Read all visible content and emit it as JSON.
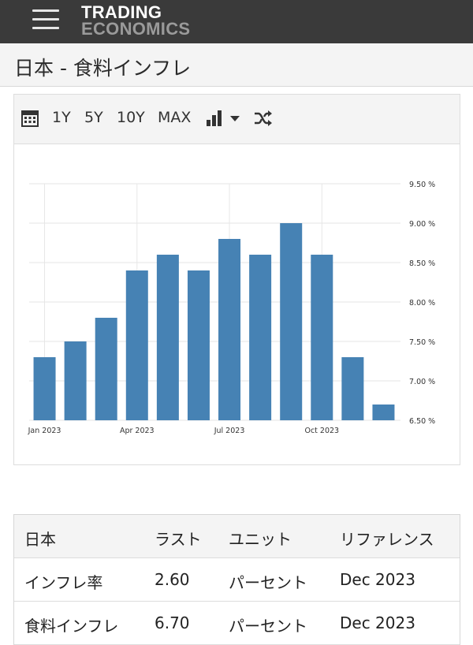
{
  "header": {
    "menu_icon": "hamburger-icon",
    "logo_line1": "TRADING",
    "logo_line2": "ECONOMICS"
  },
  "page": {
    "title": "日本 - 食料インフレ"
  },
  "toolbar": {
    "calendar_icon": "calendar-icon",
    "range_buttons": [
      "1Y",
      "5Y",
      "10Y",
      "MAX"
    ],
    "chart_type_icon": "bar-chart-icon",
    "dropdown_icon": "chevron-down-icon",
    "shuffle_icon": "shuffle-icon"
  },
  "chart_data": {
    "type": "bar",
    "categories": [
      "Jan 2023",
      "Feb 2023",
      "Mar 2023",
      "Apr 2023",
      "May 2023",
      "Jun 2023",
      "Jul 2023",
      "Aug 2023",
      "Sep 2023",
      "Oct 2023",
      "Nov 2023",
      "Dec 2023"
    ],
    "values": [
      7.3,
      7.5,
      7.8,
      8.4,
      8.6,
      8.4,
      8.8,
      8.6,
      9.0,
      8.6,
      7.3,
      6.7
    ],
    "ylim": [
      6.5,
      9.5
    ],
    "yticks": [
      9.5,
      9.0,
      8.5,
      8.0,
      7.5,
      7.0,
      6.5
    ],
    "ytick_labels": [
      "9.50 %",
      "9.00 %",
      "8.50 %",
      "8.00 %",
      "7.50 %",
      "7.00 %",
      "6.50 %"
    ],
    "xtick_labels": [
      {
        "index": 0,
        "label": "Jan 2023"
      },
      {
        "index": 3,
        "label": "Apr 2023"
      },
      {
        "index": 6,
        "label": "Jul 2023"
      },
      {
        "index": 9,
        "label": "Oct 2023"
      }
    ],
    "bar_color": "#4682b4",
    "grid": true,
    "y_axis_side": "right",
    "title": "",
    "xlabel": "",
    "ylabel": ""
  },
  "table": {
    "headers": [
      "日本",
      "ラスト",
      "ユニット",
      "リファレンス"
    ],
    "rows": [
      [
        "インフレ率",
        "2.60",
        "パーセント",
        "Dec 2023"
      ],
      [
        "食料インフレ",
        "6.70",
        "パーセント",
        "Dec 2023"
      ]
    ]
  }
}
